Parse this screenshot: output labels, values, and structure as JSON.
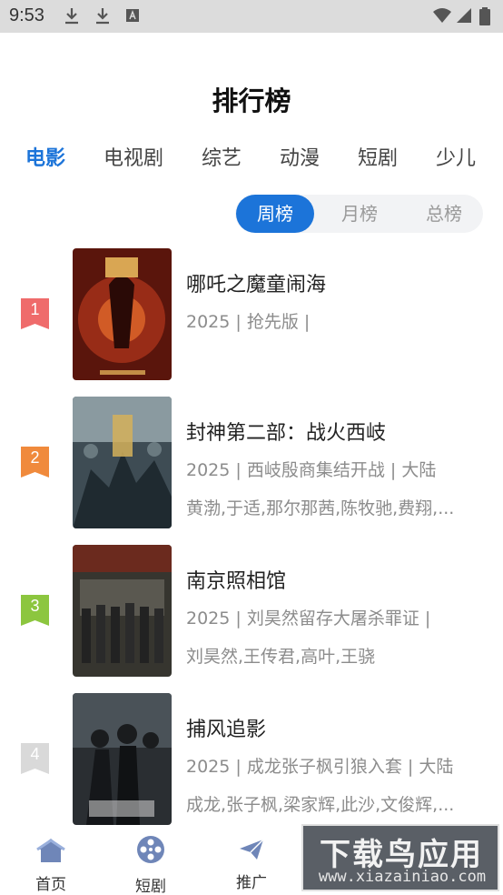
{
  "status_bar": {
    "time": "9:53"
  },
  "page_title": "排行榜",
  "category_tabs": [
    {
      "label": "电影",
      "active": true
    },
    {
      "label": "电视剧",
      "active": false
    },
    {
      "label": "综艺",
      "active": false
    },
    {
      "label": "动漫",
      "active": false
    },
    {
      "label": "短剧",
      "active": false
    },
    {
      "label": "少儿",
      "active": false
    }
  ],
  "period_tabs": [
    {
      "label": "周榜",
      "active": true
    },
    {
      "label": "月榜",
      "active": false
    },
    {
      "label": "总榜",
      "active": false
    }
  ],
  "rankings": [
    {
      "rank": "1",
      "badge_color": "#ef6b6b",
      "title": "哪吒之魔童闹海",
      "meta": "2025 | 抢先版 |",
      "cast": "",
      "poster_color": "#6a1c10"
    },
    {
      "rank": "2",
      "badge_color": "#f08a3c",
      "title": "封神第二部：战火西岐",
      "meta": "2025 | 西岐殷商集结开战 | 大陆",
      "cast": "黄渤,于适,那尔那茜,陈牧驰,费翔,...",
      "poster_color": "#4a5a62"
    },
    {
      "rank": "3",
      "badge_color": "#8cc63f",
      "title": "南京照相馆",
      "meta": "2025 | 刘昊然留存大屠杀罪证 |",
      "cast": "刘昊然,王传君,高叶,王骁",
      "poster_color": "#3b3a36"
    },
    {
      "rank": "4",
      "badge_color": "#d9d9d9",
      "title": "捕风追影",
      "meta": "2025 | 成龙张子枫引狼入套 | 大陆",
      "cast": "成龙,张子枫,梁家辉,此沙,文俊辉,...",
      "poster_color": "#2c3034"
    }
  ],
  "bottom_nav": [
    {
      "label": "首页",
      "icon": "home-icon"
    },
    {
      "label": "短剧",
      "icon": "film-reel-icon"
    },
    {
      "label": "推广",
      "icon": "paper-plane-icon"
    }
  ],
  "watermark": {
    "main": "下载鸟应用",
    "sub": "www.xiazainiao.com"
  },
  "colors": {
    "accent": "#1c74d9",
    "muted_text": "#8c8c8c"
  }
}
